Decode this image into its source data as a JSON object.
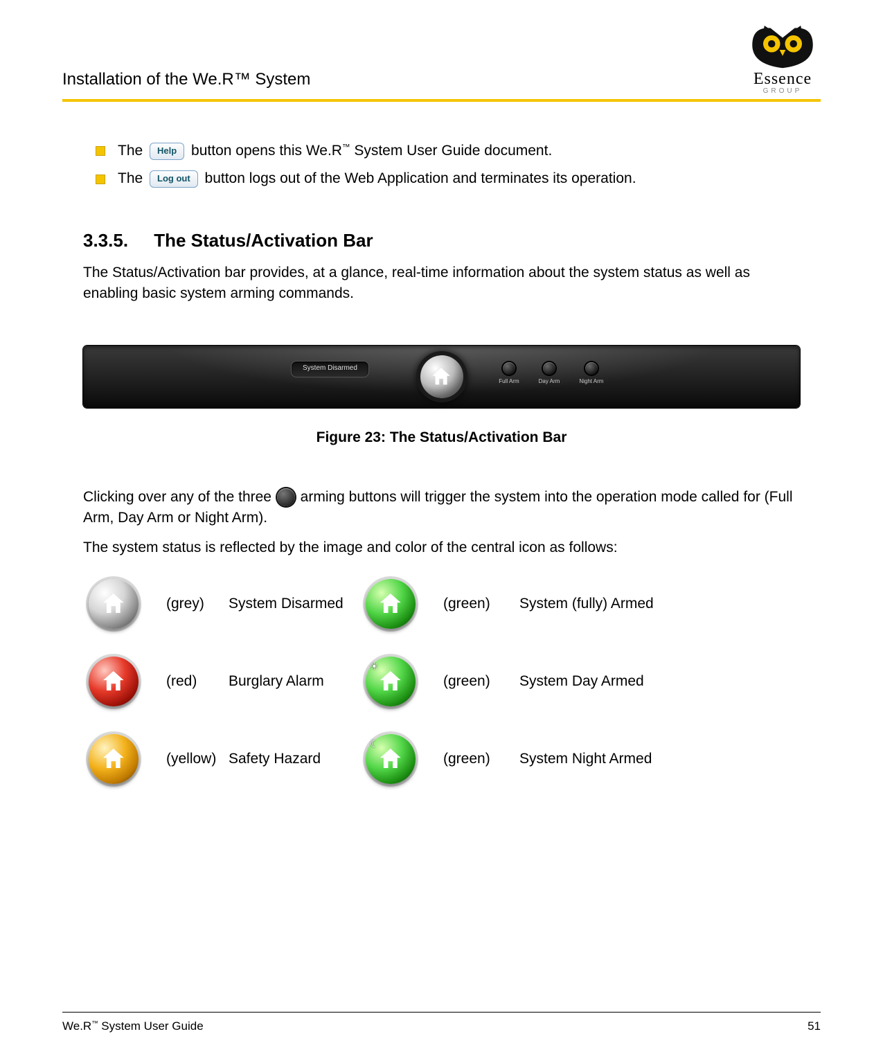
{
  "header": {
    "chapter_title": "Installation of the We.R™ System",
    "brand_name": "Essence",
    "brand_sub": "GROUP"
  },
  "bullets": {
    "b1_pre": "The ",
    "b1_btn": "Help",
    "b1_post_a": " button opens this We.R",
    "b1_tm": "™",
    "b1_post_b": " System User Guide document.",
    "b2_pre": "The ",
    "b2_btn": "Log out",
    "b2_post": " button logs out of the Web Application and terminates its operation."
  },
  "section": {
    "number": "3.3.5.",
    "title": "The Status/Activation Bar",
    "intro": "The Status/Activation bar provides, at a glance, real-time information about the system status as well as enabling basic system arming commands."
  },
  "status_bar": {
    "status_label": "System Disarmed",
    "arm_modes": {
      "full": "Full Arm",
      "day": "Day Arm",
      "night": "Night Arm"
    }
  },
  "figure_caption": "Figure 23: The Status/Activation Bar",
  "para2_a": "Clicking over any of the three ",
  "para2_b": " arming buttons will trigger the system into the operation mode called for (Full Arm, Day Arm or Night Arm).",
  "para3": "The system status is reflected by the image and color of the central icon as follows:",
  "statuses": {
    "disarmed": {
      "label": "System Disarmed",
      "color_note": "(grey)"
    },
    "full_arm": {
      "label": "System (fully) Armed",
      "color_note": "(green)"
    },
    "burglary": {
      "label": "Burglary Alarm",
      "color_note": "(red)"
    },
    "day_arm": {
      "label": "System Day Armed",
      "color_note": "(green)"
    },
    "hazard": {
      "label": "Safety Hazard",
      "color_note": "(yellow)"
    },
    "night_arm": {
      "label": "System Night Armed",
      "color_note": "(green)"
    }
  },
  "footer": {
    "left_a": "We.R",
    "left_tm": "™",
    "left_b": " System User Guide",
    "page_no": "51"
  }
}
